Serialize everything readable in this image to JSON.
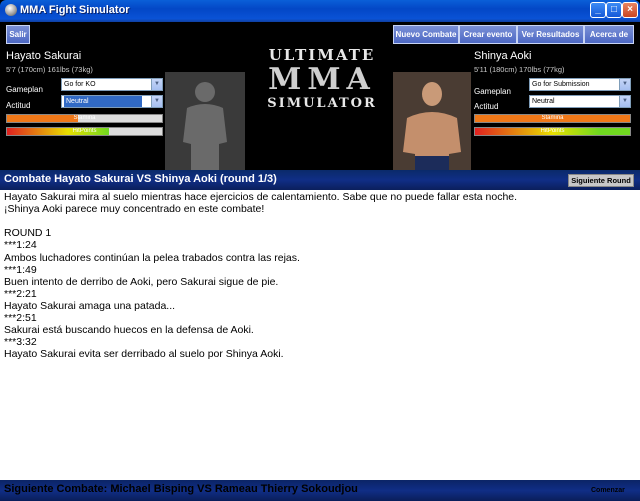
{
  "window": {
    "title": "MMA Fight Simulator"
  },
  "toolbar": {
    "salir": "Salir",
    "menu": [
      "Nuevo Combate",
      "Crear evento",
      "Ver Resultados",
      "Acerca de"
    ]
  },
  "logo": {
    "line1": "ULTIMATE",
    "line2": "MMA",
    "line3": "SIMULATOR"
  },
  "fighter_left": {
    "name": "Hayato Sakurai",
    "stats": "5'7 (170cm) 161lbs (73kg)",
    "gameplan_label": "Gameplan",
    "gameplan_value": "Go for KO",
    "actitud_label": "Actitud",
    "actitud_value": "Neutral",
    "stamina_label": "Stamina",
    "stamina_level": 0.46,
    "hitpoints_label": "HitPoints",
    "hitpoints_level": 0.66
  },
  "fighter_right": {
    "name": "Shinya Aoki",
    "stats": "5'11 (180cm) 170lbs (77kg)",
    "gameplan_label": "Gameplan",
    "gameplan_value": "Go for Submission",
    "actitud_label": "Actitud",
    "actitud_value": "Neutral",
    "stamina_label": "Stamina",
    "stamina_level": 1.0,
    "hitpoints_label": "HitPoints",
    "hitpoints_level": 1.0
  },
  "round": {
    "title": "Combate Hayato Sakurai VS Shinya Aoki (round 1/3)",
    "next_button": "Siguiente Round"
  },
  "log": [
    "Hayato Sakurai mira al suelo mientras hace ejercicios de calentamiento. Sabe que no puede fallar esta noche.",
    "¡Shinya Aoki parece muy concentrado en este combate!",
    "",
    "ROUND 1",
    "***1:24",
    "Ambos luchadores continúan la pelea trabados contra las rejas.",
    "***1:49",
    "Buen intento de derribo de Aoki, pero Sakurai sigue de pie.",
    "***2:21",
    "Hayato Sakurai amaga una patada...",
    "***2:51",
    "Sakurai está buscando huecos en la defensa de Aoki.",
    "***3:32",
    "Hayato Sakurai evita ser derribado al suelo por Shinya Aoki."
  ],
  "footer": {
    "next_fight": "Siguiente Combate: Michael Bisping VS Rameau Thierry Sokoudjou",
    "start": "Comenzar"
  },
  "colors": {
    "stamina": "#f07818",
    "hitpoints_left": "#e8e000",
    "hitpoints_right": "#70d820"
  }
}
